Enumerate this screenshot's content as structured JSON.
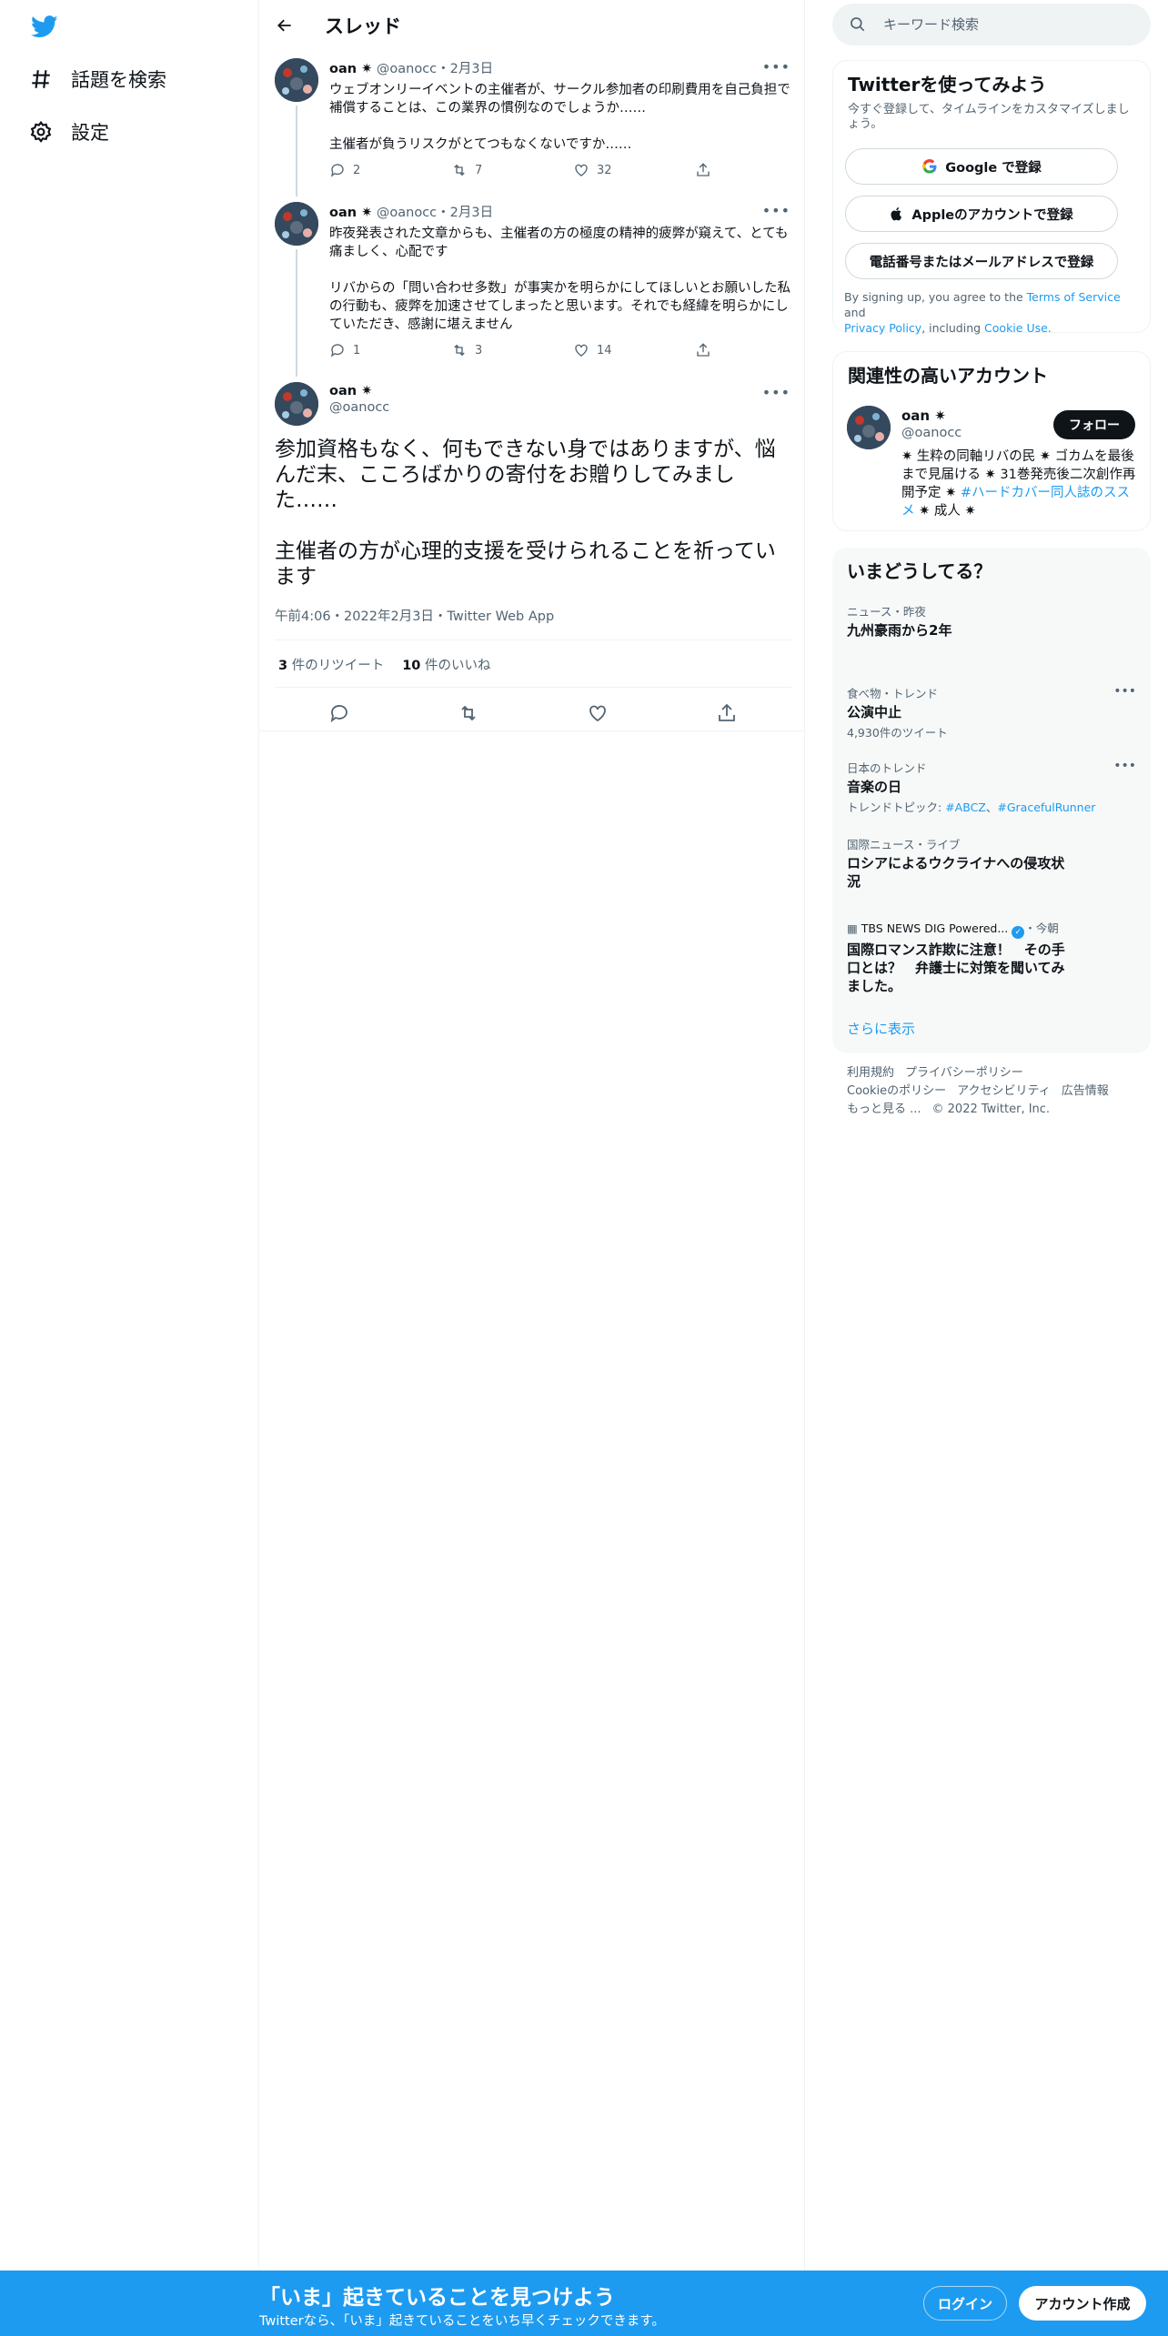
{
  "colors": {
    "brand": "#1d9bf0",
    "text": "#0f1419",
    "secondary": "#536471",
    "border": "#eff3f4"
  },
  "nav": {
    "logo_icon": "twitter-bird-icon",
    "explore_label": "話題を検索",
    "settings_label": "設定"
  },
  "header": {
    "title": "スレッド"
  },
  "thread": [
    {
      "name": "oan ✷",
      "handle": "@oanocc",
      "date": "・2月3日",
      "paragraphs": [
        "ウェブオンリーイベントの主催者が、サークル参加者の印刷費用を自己負担で補償することは、この業界の慣例なのでしょうか……",
        "主催者が負うリスクがとてつもなくないですか……"
      ],
      "replies": "2",
      "retweets": "7",
      "likes": "32"
    },
    {
      "name": "oan ✷",
      "handle": "@oanocc",
      "date": "・2月3日",
      "paragraphs": [
        "昨夜発表された文章からも、主催者の方の極度の精神的疲弊が窺えて、とても痛ましく、心配です",
        "リバからの「問い合わせ多数」が事実かを明らかにしてほしいとお願いした私の行動も、疲弊を加速させてしまったと思います。それでも経緯を明らかにしていただき、感謝に堪えません"
      ],
      "replies": "1",
      "retweets": "3",
      "likes": "14"
    }
  ],
  "focus": {
    "name": "oan ✷",
    "handle": "@oanocc",
    "paragraphs": [
      "参加資格もなく、何もできない身ではありますが、悩んだ末、こころばかりの寄付をお贈りしてみました……",
      "主催者の方が心理的支援を受けられることを祈っています"
    ],
    "meta": "午前4:06・2022年2月3日・Twitter Web App",
    "retweet_count": "3",
    "retweet_label": "件のリツイート",
    "like_count": "10",
    "like_label": "件のいいね"
  },
  "search": {
    "placeholder": "キーワード検索"
  },
  "signup_card": {
    "title": "Twitterを使ってみよう",
    "subtitle": "今すぐ登録して、タイムラインをカスタマイズしましょう。",
    "google": "Google で登録",
    "apple": "Appleのアカウントで登録",
    "phone": "電話番号またはメールアドレスで登録",
    "terms_1": "By signing up, you agree to the",
    "terms_link1": "Terms of Service",
    "terms_2": "and",
    "terms_link2": "Privacy Policy",
    "terms_3": ", including",
    "terms_link3": "Cookie Use."
  },
  "related": {
    "title": "関連性の高いアカウント",
    "name": "oan ✷",
    "handle": "@oanocc",
    "follow": "フォロー",
    "bio_1": "✷ 生粋の同軸リバの民 ✷ ゴカムを最後まで見届ける ✷ 31巻発売後二次創作再開予定 ✷",
    "bio_link": "#ハードカバー同人誌のススメ",
    "bio_2": "✷ 成人 ✷"
  },
  "trends": {
    "title": "いまどうしてる？",
    "items": [
      {
        "context": "ニュース・昨夜",
        "name": "九州豪雨から2年",
        "meta": ""
      },
      {
        "context": "食べ物・トレンド",
        "name": "公演中止",
        "meta": "4,930件のツイート"
      },
      {
        "context": "日本のトレンド",
        "name": "音楽の日",
        "meta_prefix": "トレンドトピック: ",
        "tag1": "#ABCZ",
        "sep": "、",
        "tag2": "#GracefulRunner"
      },
      {
        "context": "国際ニュース・ライブ",
        "name": "ロシアによるウクライナへの侵攻状況",
        "meta": ""
      },
      {
        "source": "TBS NEWS DIG Powered...",
        "when": "・今朝",
        "name": "国際ロマンス詐欺に注意！　その手口とは？　弁護士に対策を聞いてみました。"
      }
    ],
    "show_more": "さらに表示"
  },
  "footer": {
    "terms": "利用規約",
    "privacy": "プライバシーポリシー",
    "cookie": "Cookieのポリシー",
    "accessibility": "アクセシビリティ",
    "ads": "広告情報",
    "more": "もっと見る ...",
    "copyright": "© 2022 Twitter, Inc."
  },
  "bottom_bar": {
    "title": "「いま」起きていることを見つけよう",
    "subtitle": "Twitterなら、「いま」起きていることをいち早くチェックできます。",
    "login": "ログイン",
    "signup": "アカウント作成"
  }
}
